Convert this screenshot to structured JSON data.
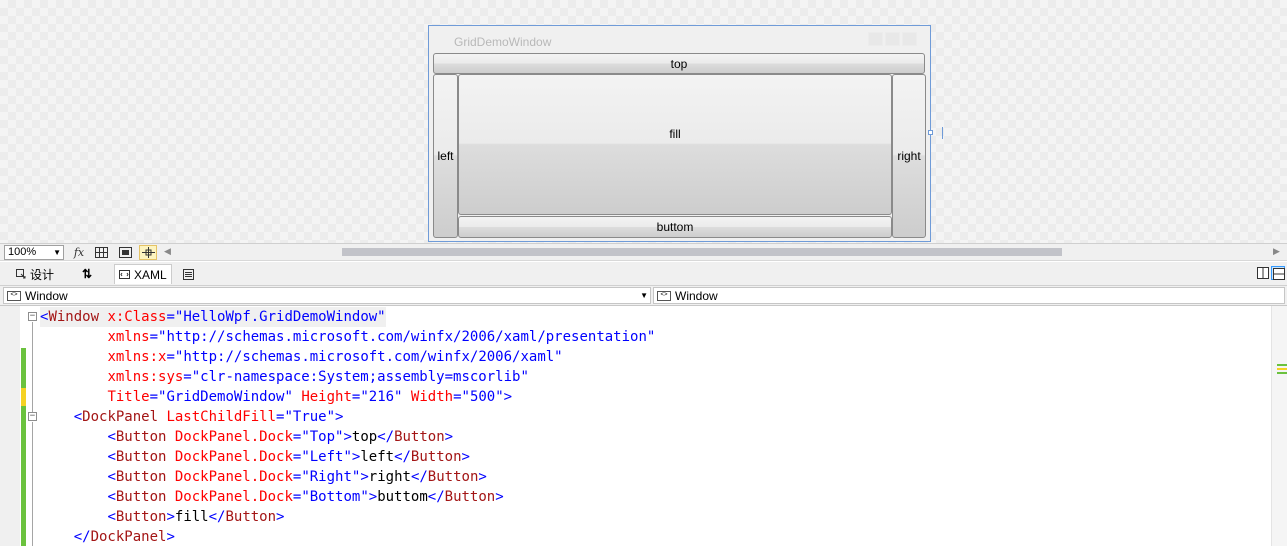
{
  "designer": {
    "window_title": "GridDemoWindow",
    "buttons": {
      "top": "top",
      "left": "left",
      "right": "right",
      "fill": "fill",
      "bottom": "buttom"
    }
  },
  "toolbar": {
    "zoom": "100%",
    "fx_label": "fx"
  },
  "tabs": {
    "design": "设计",
    "swap": "⇅",
    "xaml": "XAML"
  },
  "navigation": {
    "left_combo": "Window",
    "right_combo": "Window"
  },
  "editor": {
    "lines": [
      {
        "indent": "",
        "tokens": [
          {
            "t": "<",
            "c": "c-br"
          },
          {
            "t": "Window",
            "c": "c-tag"
          },
          {
            "t": " x:Class",
            "c": "c-attr"
          },
          {
            "t": "=",
            "c": "c-br"
          },
          {
            "t": "\"HelloWpf.GridDemoWindow\"",
            "c": "c-val"
          }
        ]
      },
      {
        "indent": "        ",
        "tokens": [
          {
            "t": "xmlns",
            "c": "c-attr"
          },
          {
            "t": "=",
            "c": "c-br"
          },
          {
            "t": "\"http://schemas.microsoft.com/winfx/2006/xaml/presentation\"",
            "c": "c-val"
          }
        ]
      },
      {
        "indent": "        ",
        "tokens": [
          {
            "t": "xmlns:x",
            "c": "c-attr"
          },
          {
            "t": "=",
            "c": "c-br"
          },
          {
            "t": "\"http://schemas.microsoft.com/winfx/2006/xaml\"",
            "c": "c-val"
          }
        ]
      },
      {
        "indent": "        ",
        "tokens": [
          {
            "t": "xmlns:sys",
            "c": "c-attr"
          },
          {
            "t": "=",
            "c": "c-br"
          },
          {
            "t": "\"clr-namespace:System;assembly=mscorlib\"",
            "c": "c-val"
          }
        ]
      },
      {
        "indent": "        ",
        "tokens": [
          {
            "t": "Title",
            "c": "c-attr"
          },
          {
            "t": "=",
            "c": "c-br"
          },
          {
            "t": "\"GridDemoWindow\"",
            "c": "c-val"
          },
          {
            "t": " Height",
            "c": "c-attr"
          },
          {
            "t": "=",
            "c": "c-br"
          },
          {
            "t": "\"216\"",
            "c": "c-val"
          },
          {
            "t": " Width",
            "c": "c-attr"
          },
          {
            "t": "=",
            "c": "c-br"
          },
          {
            "t": "\"500\"",
            "c": "c-val"
          },
          {
            "t": ">",
            "c": "c-br"
          }
        ]
      },
      {
        "indent": "    ",
        "tokens": [
          {
            "t": "<",
            "c": "c-br"
          },
          {
            "t": "DockPanel",
            "c": "c-tag"
          },
          {
            "t": " LastChildFill",
            "c": "c-attr"
          },
          {
            "t": "=",
            "c": "c-br"
          },
          {
            "t": "\"True\"",
            "c": "c-val"
          },
          {
            "t": ">",
            "c": "c-br"
          }
        ]
      },
      {
        "indent": "        ",
        "tokens": [
          {
            "t": "<",
            "c": "c-br"
          },
          {
            "t": "Button",
            "c": "c-tag"
          },
          {
            "t": " DockPanel.Dock",
            "c": "c-attr"
          },
          {
            "t": "=",
            "c": "c-br"
          },
          {
            "t": "\"Top\"",
            "c": "c-val"
          },
          {
            "t": ">",
            "c": "c-br"
          },
          {
            "t": "top",
            "c": "c-text"
          },
          {
            "t": "</",
            "c": "c-br"
          },
          {
            "t": "Button",
            "c": "c-tag"
          },
          {
            "t": ">",
            "c": "c-br"
          }
        ]
      },
      {
        "indent": "        ",
        "tokens": [
          {
            "t": "<",
            "c": "c-br"
          },
          {
            "t": "Button",
            "c": "c-tag"
          },
          {
            "t": " DockPanel.Dock",
            "c": "c-attr"
          },
          {
            "t": "=",
            "c": "c-br"
          },
          {
            "t": "\"Left\"",
            "c": "c-val"
          },
          {
            "t": ">",
            "c": "c-br"
          },
          {
            "t": "left",
            "c": "c-text"
          },
          {
            "t": "</",
            "c": "c-br"
          },
          {
            "t": "Button",
            "c": "c-tag"
          },
          {
            "t": ">",
            "c": "c-br"
          }
        ]
      },
      {
        "indent": "        ",
        "tokens": [
          {
            "t": "<",
            "c": "c-br"
          },
          {
            "t": "Button",
            "c": "c-tag"
          },
          {
            "t": " DockPanel.Dock",
            "c": "c-attr"
          },
          {
            "t": "=",
            "c": "c-br"
          },
          {
            "t": "\"Right\"",
            "c": "c-val"
          },
          {
            "t": ">",
            "c": "c-br"
          },
          {
            "t": "right",
            "c": "c-text"
          },
          {
            "t": "</",
            "c": "c-br"
          },
          {
            "t": "Button",
            "c": "c-tag"
          },
          {
            "t": ">",
            "c": "c-br"
          }
        ]
      },
      {
        "indent": "        ",
        "tokens": [
          {
            "t": "<",
            "c": "c-br"
          },
          {
            "t": "Button",
            "c": "c-tag"
          },
          {
            "t": " DockPanel.Dock",
            "c": "c-attr"
          },
          {
            "t": "=",
            "c": "c-br"
          },
          {
            "t": "\"Bottom\"",
            "c": "c-val"
          },
          {
            "t": ">",
            "c": "c-br"
          },
          {
            "t": "buttom",
            "c": "c-text"
          },
          {
            "t": "</",
            "c": "c-br"
          },
          {
            "t": "Button",
            "c": "c-tag"
          },
          {
            "t": ">",
            "c": "c-br"
          }
        ]
      },
      {
        "indent": "        ",
        "tokens": [
          {
            "t": "<",
            "c": "c-br"
          },
          {
            "t": "Button",
            "c": "c-tag"
          },
          {
            "t": ">",
            "c": "c-br"
          },
          {
            "t": "fill",
            "c": "c-text"
          },
          {
            "t": "</",
            "c": "c-br"
          },
          {
            "t": "Button",
            "c": "c-tag"
          },
          {
            "t": ">",
            "c": "c-br"
          }
        ]
      },
      {
        "indent": "    ",
        "tokens": [
          {
            "t": "</",
            "c": "c-br"
          },
          {
            "t": "DockPanel",
            "c": "c-tag"
          },
          {
            "t": ">",
            "c": "c-br"
          }
        ]
      }
    ]
  }
}
